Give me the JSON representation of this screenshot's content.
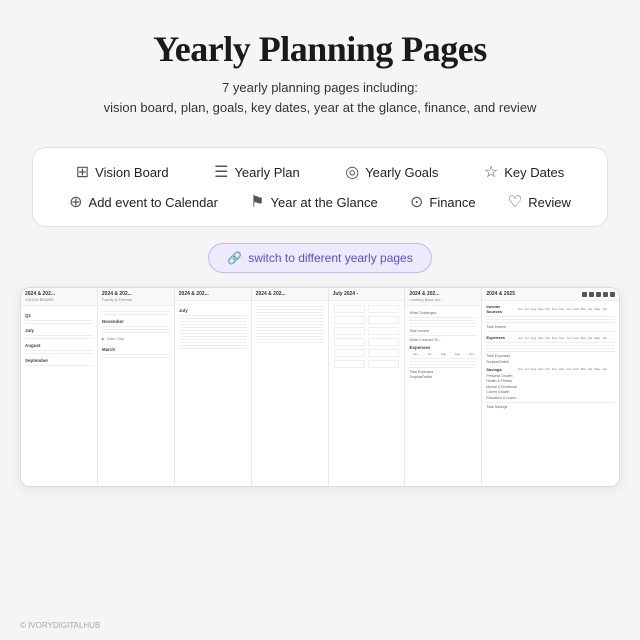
{
  "header": {
    "title": "Yearly Planning Pages",
    "subtitle_line1": "7 yearly planning pages including:",
    "subtitle_line2": "vision board, plan, goals, key dates, year at the glance, finance, and review"
  },
  "nav": {
    "row1": [
      {
        "icon": "⊞",
        "label": "Vision Board"
      },
      {
        "icon": "☰",
        "label": "Yearly Plan"
      },
      {
        "icon": "◎",
        "label": "Yearly Goals"
      },
      {
        "icon": "☆",
        "label": "Key Dates"
      }
    ],
    "row2": [
      {
        "icon": "⊕",
        "label": "Add event to Calendar"
      },
      {
        "icon": "⚑",
        "label": "Year at the Glance"
      },
      {
        "icon": "⊙",
        "label": "Finance"
      },
      {
        "icon": "♡",
        "label": "Review"
      }
    ]
  },
  "switch_button": "switch to different yearly pages",
  "pages": [
    {
      "id": "vision-board",
      "title": "2024 & 202",
      "subtitle": "VISION BOARD",
      "sections": [
        "Q1",
        "July",
        "August",
        "September"
      ]
    },
    {
      "id": "yearly-plan",
      "title": "2024 & 202",
      "subtitle": "Family & Friends",
      "sections": [
        "November",
        "March"
      ]
    },
    {
      "id": "yearly-goals",
      "title": "2024 & 202",
      "subtitle": "",
      "sections": [
        "July"
      ]
    },
    {
      "id": "key-dates",
      "title": "2024 & 202",
      "subtitle": "",
      "sections": []
    },
    {
      "id": "year-glance",
      "title": "July 2024 -",
      "subtitle": "",
      "sections": []
    },
    {
      "id": "finance-review",
      "title": "2024 & 202",
      "subtitle": "Looking Back at t",
      "sections": [
        "What Challenges",
        "Total Income",
        "What I Learned Th"
      ]
    },
    {
      "id": "finance-main",
      "title": "2024 & 2025",
      "subtitle": "Income Sources",
      "cols": [
        "Jun",
        "Jul",
        "Aug",
        "Sep",
        "Oct",
        "Nov",
        "Dec",
        "Jan",
        "Feb",
        "Mar",
        "Apr",
        "May",
        "Jun"
      ],
      "expense_label": "Expenses",
      "savings_sections": [
        "Personal Growth",
        "Health & Fitness",
        "Mental & Emotional",
        "Career Growth",
        "Education & Learni"
      ],
      "total_savings": "Total Savings"
    }
  ],
  "brand": "© IVORYDIGITALHUB"
}
